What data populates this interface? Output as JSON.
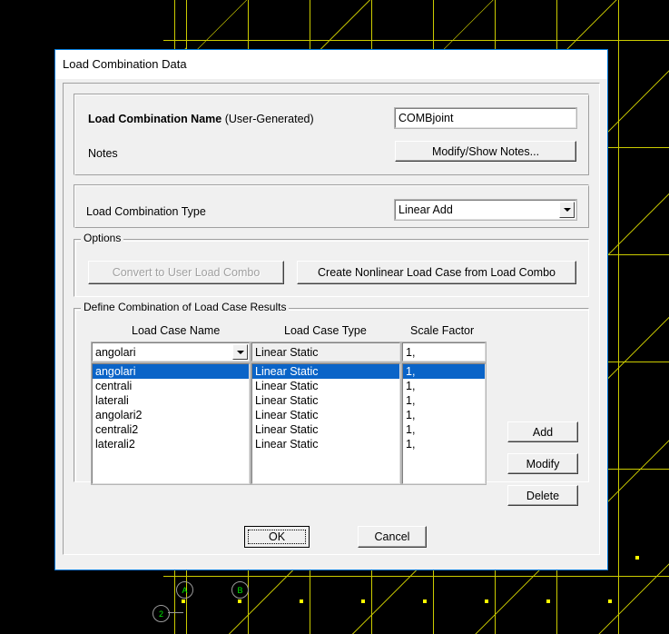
{
  "window": {
    "title": "Load Combination Data"
  },
  "name_group": {
    "label_bold": "Load Combination Name",
    "label_normal": " (User-Generated)",
    "name_value": "COMBjoint",
    "notes_label": "Notes",
    "notes_button": "Modify/Show Notes..."
  },
  "type_group": {
    "label": "Load Combination Type",
    "value": "Linear Add",
    "dropdown_icon": "chevron-down-icon"
  },
  "options_group": {
    "caption": "Options",
    "convert_button": "Convert to User Load Combo",
    "convert_enabled": false,
    "create_nonlinear_button": "Create Nonlinear Load Case from Load Combo"
  },
  "define_group": {
    "caption": "Define Combination of Load Case Results",
    "headers": {
      "name": "Load Case Name",
      "type": "Load Case Type",
      "scale": "Scale Factor"
    },
    "editor": {
      "name_value": "angolari",
      "type_value": "Linear Static",
      "scale_value": "1,"
    },
    "rows": [
      {
        "name": "angolari",
        "type": "Linear Static",
        "scale": "1,",
        "selected": true
      },
      {
        "name": "centrali",
        "type": "Linear Static",
        "scale": "1,",
        "selected": false
      },
      {
        "name": "laterali",
        "type": "Linear Static",
        "scale": "1,",
        "selected": false
      },
      {
        "name": "angolari2",
        "type": "Linear Static",
        "scale": "1,",
        "selected": false
      },
      {
        "name": "centrali2",
        "type": "Linear Static",
        "scale": "1,",
        "selected": false
      },
      {
        "name": "laterali2",
        "type": "Linear Static",
        "scale": "1,",
        "selected": false
      }
    ],
    "side_buttons": {
      "add": "Add",
      "modify": "Modify",
      "delete": "Delete"
    }
  },
  "footer": {
    "ok": "OK",
    "cancel": "Cancel"
  },
  "background": {
    "grid_bubbles": [
      {
        "label": "A"
      },
      {
        "label": "B"
      },
      {
        "label": "2"
      }
    ]
  },
  "colors": {
    "dialog_border": "#0078d7",
    "selection": "#0a64c8",
    "face": "#f0f0f0",
    "model_line": "#cccc00",
    "model_node": "#ffff00",
    "bubble_text": "#00ee00"
  }
}
